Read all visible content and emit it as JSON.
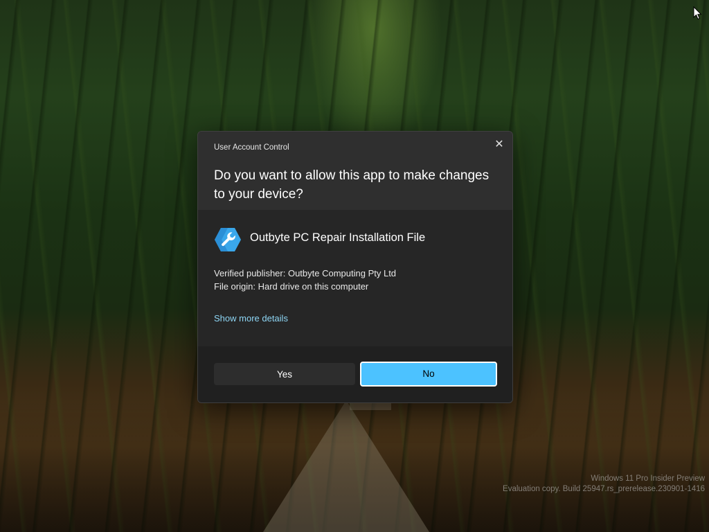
{
  "uac": {
    "caption": "User Account Control",
    "close_symbol": "✕",
    "question": "Do you want to allow this app to make changes to your device?",
    "app_name": "Outbyte PC Repair Installation File",
    "app_icon": "wrench-hexagon-icon",
    "publisher": "Verified publisher: Outbyte Computing Pty Ltd",
    "origin": "File origin: Hard drive on this computer",
    "more_details": "Show more details",
    "yes_label": "Yes",
    "no_label": "No",
    "accent_color": "#4cc2ff",
    "link_color": "#8ed6f5"
  },
  "desktop": {
    "watermark_line1": "Windows 11 Pro Insider Preview",
    "watermark_line2": "Evaluation copy. Build 25947.rs_prerelease.230901-1416"
  }
}
